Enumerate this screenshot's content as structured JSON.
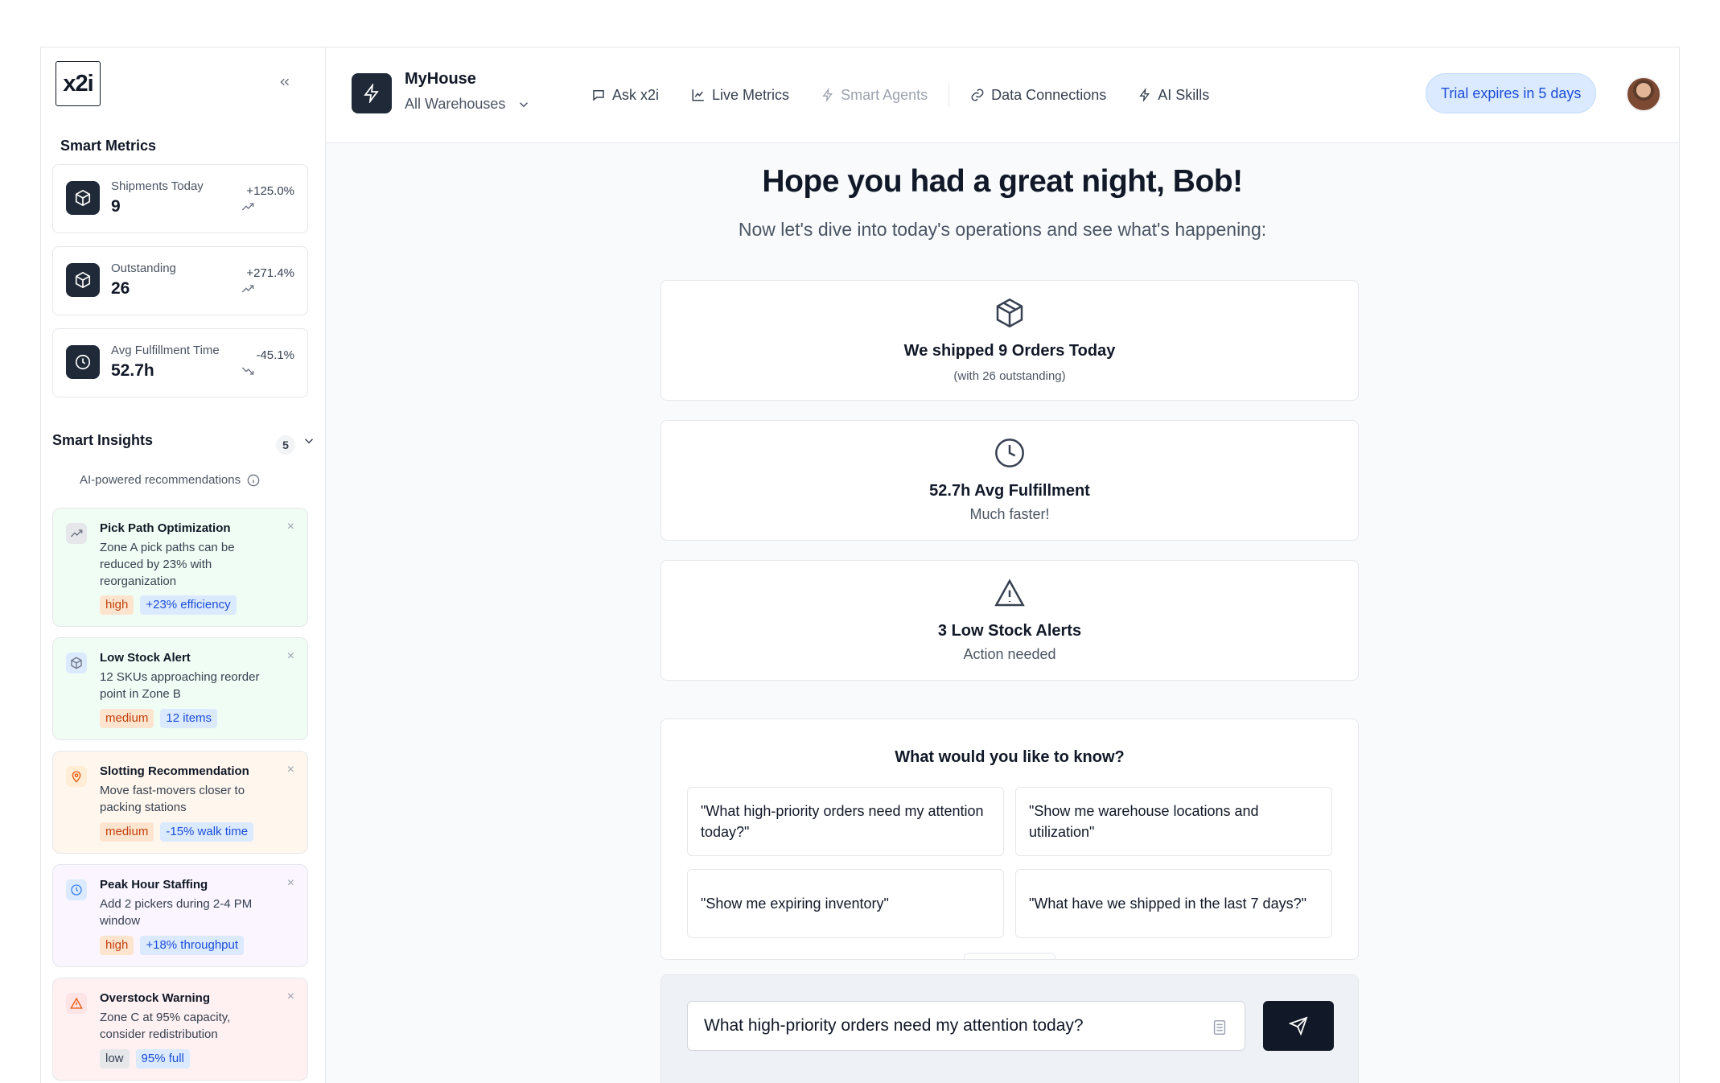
{
  "brand": {
    "logo_text": "x2i"
  },
  "sidebar": {
    "smart_metrics_title": "Smart Metrics",
    "metrics": [
      {
        "label": "Shipments Today",
        "value": "9",
        "change": "+125.0%",
        "trend": "up",
        "icon": "box-icon"
      },
      {
        "label": "Outstanding",
        "value": "26",
        "change": "+271.4%",
        "trend": "up",
        "icon": "box-icon"
      },
      {
        "label": "Avg Fulfillment Time",
        "value": "52.7h",
        "change": "-45.1%",
        "trend": "down",
        "icon": "clock-icon"
      }
    ],
    "insights_title": "Smart Insights",
    "insights_count": "5",
    "ai_recommendations": "AI-powered recommendations",
    "insights": [
      {
        "title": "Pick Path Optimization",
        "desc": "Zone A pick paths can be reduced by 23% with reorganization",
        "priority": "high",
        "impact": "+23% efficiency",
        "icon": "trending-icon",
        "bg": "#f0fdf4",
        "icon_bg": "#e5e7eb"
      },
      {
        "title": "Low Stock Alert",
        "desc": "12 SKUs approaching reorder point in Zone B",
        "priority": "medium",
        "impact": "12 items",
        "icon": "box-icon",
        "bg": "#f0fdf4",
        "icon_bg": "#dbeafe"
      },
      {
        "title": "Slotting Recommendation",
        "desc": "Move fast-movers closer to packing stations",
        "priority": "medium",
        "impact": "-15% walk time",
        "icon": "map-pin-icon",
        "bg": "#fff7ed",
        "icon_bg": "#ffedd5"
      },
      {
        "title": "Peak Hour Staffing",
        "desc": "Add 2 pickers during 2-4 PM window",
        "priority": "high",
        "impact": "+18% throughput",
        "icon": "clock-icon",
        "bg": "#faf5ff",
        "icon_bg": "#dbeafe"
      },
      {
        "title": "Overstock Warning",
        "desc": "Zone C at 95% capacity, consider redistribution",
        "priority": "low",
        "impact": "95% full",
        "icon": "warning-icon",
        "bg": "#fff1f2",
        "icon_bg": "#ffe4e6"
      }
    ]
  },
  "header": {
    "org_name": "MyHouse",
    "warehouse_select": "All Warehouses",
    "nav": [
      {
        "label": "Ask x2i",
        "icon": "chat-icon"
      },
      {
        "label": "Live Metrics",
        "icon": "chart-icon"
      },
      {
        "label": "Smart Agents",
        "icon": "bolt-icon",
        "dim": true
      },
      {
        "label": "Data Connections",
        "icon": "link-icon"
      },
      {
        "label": "AI Skills",
        "icon": "bolt-icon"
      }
    ],
    "trial": "Trial expires in 5 days"
  },
  "main": {
    "greeting": "Hope you had a great night, Bob!",
    "subtitle": "Now let's dive into today's operations and see what's happening:",
    "cards": [
      {
        "title": "We shipped 9 Orders Today",
        "sub": "(with 26 outstanding)",
        "icon": "box-icon"
      },
      {
        "title": "52.7h Avg Fulfillment",
        "sub": "Much faster!",
        "icon": "clock-icon"
      },
      {
        "title": "3 Low Stock Alerts",
        "sub": "Action needed",
        "icon": "warning-icon"
      }
    ],
    "ask_title": "What would you like to know?",
    "suggestions": [
      "\"What high-priority orders need my attention today?\"",
      "\"Show me warehouse locations and utilization\"",
      "\"Show me expiring inventory\"",
      "\"What have we shipped in the last 7 days?\""
    ],
    "composer_value": "What high-priority orders need my attention today?"
  },
  "colors": {
    "dark": "#1f2937",
    "accent_blue": "#1d4ed8",
    "trial_bg": "#dbeafe"
  }
}
